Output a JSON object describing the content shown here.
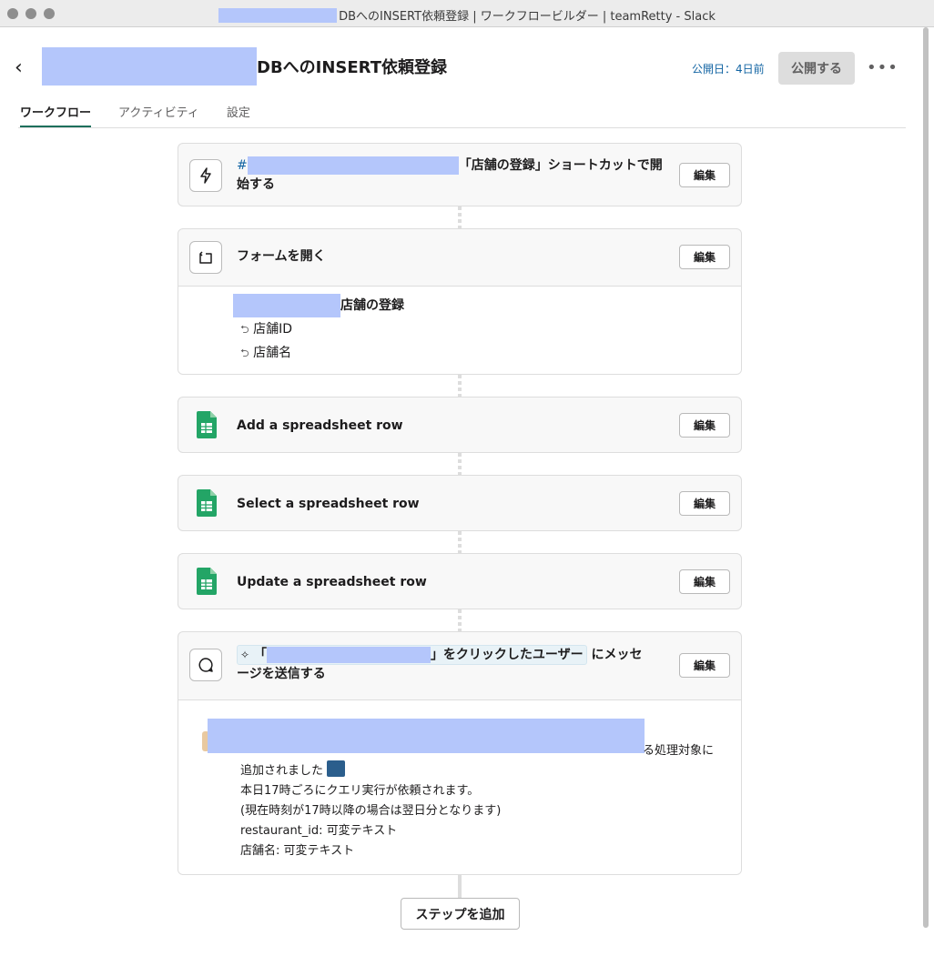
{
  "window": {
    "title_suffix": "DBへのINSERT依頼登録 | ワークフロービルダー | teamRetty - Slack"
  },
  "header": {
    "title_suffix": "DBへのINSERT依頼登録",
    "published": "公開日：4日前",
    "publish_label": "公開する"
  },
  "tabs": [
    {
      "label": "ワークフロー",
      "active": true
    },
    {
      "label": "アクティビティ",
      "active": false
    },
    {
      "label": "設定",
      "active": false
    }
  ],
  "steps": {
    "trigger": {
      "hash": "#",
      "text_line1": "「店舗の登録」ショートカットで開",
      "text_line2": "始する",
      "edit": "編集"
    },
    "form": {
      "title": "フォームを開く",
      "edit": "編集",
      "form_name_suffix": "店舗の登録",
      "fields": [
        "店舗ID",
        "店舗名"
      ]
    },
    "sheet_steps": [
      {
        "title": "Add a spreadsheet row",
        "edit": "編集"
      },
      {
        "title": "Select a spreadsheet row",
        "edit": "編集"
      },
      {
        "title": "Update a spreadsheet row",
        "edit": "編集"
      }
    ],
    "message": {
      "chip_prefix": "「",
      "chip_suffix": "」をクリックしたユーザー",
      "text_after_chip": "にメッセ",
      "text_line2": "ージを送信する",
      "edit": "編集",
      "body": {
        "line1_tail": "る処理対象に",
        "line2": "追加されました",
        "line3": "本日17時ごろにクエリ実行が依頼されます。",
        "line4": "(現在時刻が17時以降の場合は翌日分となります)",
        "line5": "restaurant_id: 可変テキスト",
        "line6": "店舗名: 可変テキスト"
      }
    }
  },
  "add_step_label": "ステップを追加",
  "colors": {
    "accent_tab": "#1d6f5c",
    "link": "#1264a3",
    "redaction": "#b4c6fb",
    "sheet_green": "#23a566"
  }
}
